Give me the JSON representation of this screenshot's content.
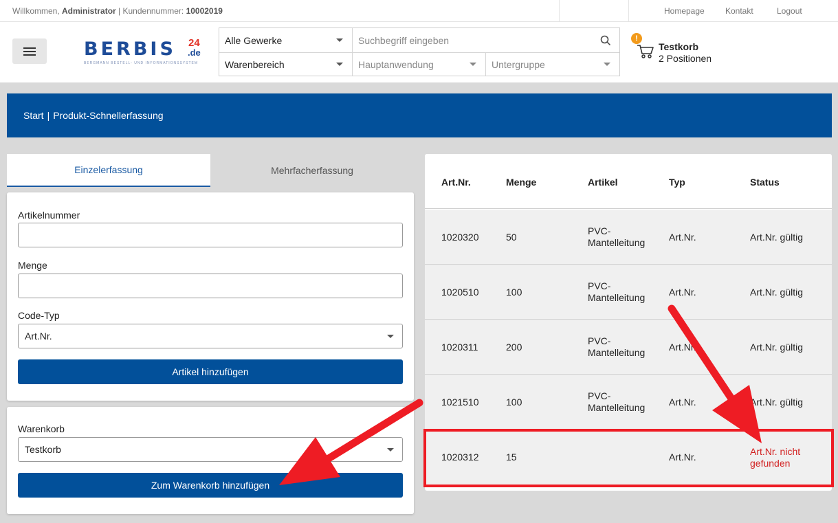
{
  "topbar": {
    "welcome_prefix": "Willkommen,",
    "user": "Administrator",
    "customer_prefix": "| Kundennummer:",
    "customer_number": "10002019",
    "links": [
      "Homepage",
      "Kontakt",
      "Logout"
    ]
  },
  "header": {
    "logo_brand": "BERBIS",
    "logo_number": "24",
    "logo_tld": ".de",
    "logo_tagline": "BERGMANN BESTELL- UND INFORMATIONSSYSTEM",
    "trade_select": "Alle Gewerke",
    "search_placeholder": "Suchbegriff eingeben",
    "area_select": "Warenbereich",
    "application_select": "Hauptanwendung",
    "subgroup_select": "Untergruppe",
    "cart_badge": "!",
    "cart_name": "Testkorb",
    "cart_positions": "2 Positionen"
  },
  "breadcrumb": {
    "home": "Start",
    "sep": "|",
    "current": "Produkt-Schnellerfassung"
  },
  "tabs": {
    "single": "Einzelerfassung",
    "multiple": "Mehrfacherfassung"
  },
  "form": {
    "article_label": "Artikelnummer",
    "article_value": "",
    "quantity_label": "Menge",
    "quantity_value": "",
    "code_type_label": "Code-Typ",
    "code_type_value": "Art.Nr.",
    "add_article_button": "Artikel hinzufügen"
  },
  "cart_form": {
    "label": "Warenkorb",
    "value": "Testkorb",
    "add_to_cart_button": "Zum Warenkorb hinzufügen"
  },
  "table": {
    "headers": [
      "Art.Nr.",
      "Menge",
      "Artikel",
      "Typ",
      "Status"
    ],
    "rows": [
      {
        "artnr": "1020320",
        "menge": "50",
        "artikel_1": "PVC-",
        "artikel_2": "Mantelleitung",
        "typ": "Art.Nr.",
        "status_1": "Art.Nr. gültig",
        "status_2": ""
      },
      {
        "artnr": "1020510",
        "menge": "100",
        "artikel_1": "PVC-",
        "artikel_2": "Mantelleitung",
        "typ": "Art.Nr.",
        "status_1": "Art.Nr. gültig",
        "status_2": ""
      },
      {
        "artnr": "1020311",
        "menge": "200",
        "artikel_1": "PVC-",
        "artikel_2": "Mantelleitung",
        "typ": "Art.Nr.",
        "status_1": "Art.Nr. gültig",
        "status_2": ""
      },
      {
        "artnr": "1021510",
        "menge": "100",
        "artikel_1": "PVC-",
        "artikel_2": "Mantelleitung",
        "typ": "Art.Nr.",
        "status_1": "Art.Nr. gültig",
        "status_2": ""
      },
      {
        "artnr": "1020312",
        "menge": "15",
        "artikel_1": "",
        "artikel_2": "",
        "typ": "Art.Nr.",
        "status_1": "Art.Nr. nicht",
        "status_2": "gefunden"
      }
    ]
  },
  "colors": {
    "primary": "#02509a",
    "error": "#d22020",
    "annotation": "#ee1c24",
    "badge": "#f29a1b"
  }
}
